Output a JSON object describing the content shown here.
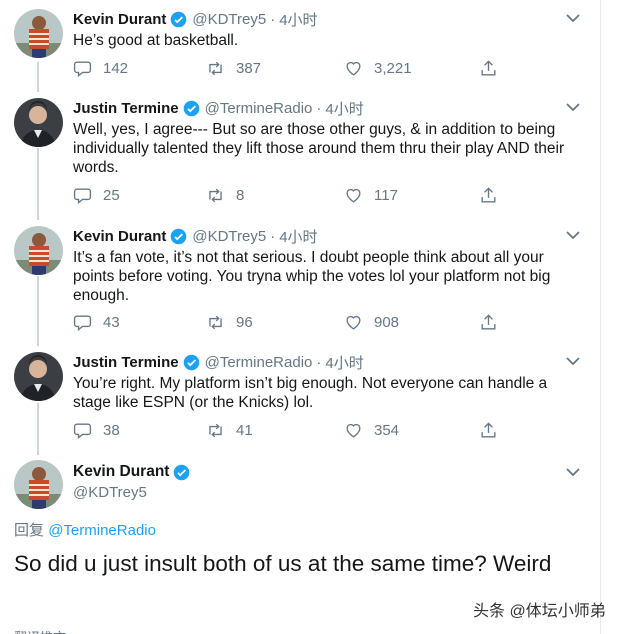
{
  "tweets": [
    {
      "name": "Kevin Durant",
      "handle": "@KDTrey5",
      "time": "4小时",
      "text": "He’s good at basketball.",
      "replies": "142",
      "retweets": "387",
      "likes": "3,221"
    },
    {
      "name": "Justin Termine",
      "handle": "@TermineRadio",
      "time": "4小时",
      "text": "Well, yes, I agree---  But so are those other guys, & in addition to being individually talented they lift those around them thru their play AND their words.",
      "replies": "25",
      "retweets": "8",
      "likes": "117"
    },
    {
      "name": "Kevin Durant",
      "handle": "@KDTrey5",
      "time": "4小时",
      "text": "It’s a fan vote, it’s not that serious. I doubt people think about all your points before voting. You tryna whip the votes lol your platform not big enough.",
      "replies": "43",
      "retweets": "96",
      "likes": "908"
    },
    {
      "name": "Justin Termine",
      "handle": "@TermineRadio",
      "time": "4小时",
      "text": "You’re right. My platform isn’t big enough. Not everyone can handle a stage like ESPN (or the Knicks) lol.",
      "replies": "38",
      "retweets": "41",
      "likes": "354"
    }
  ],
  "main_tweet": {
    "name": "Kevin Durant",
    "handle": "@KDTrey5",
    "reply_prefix": "回复",
    "reply_to": "@TermineRadio",
    "text": "So did u just insult both of us at the same time? Weird"
  },
  "watermark": "头条 @体坛小师弟",
  "cut_text": "翻译推文",
  "colors": {
    "accent": "#1da1f2",
    "secondary_text": "#657786",
    "thread_line": "#ccd6dd"
  },
  "icons": [
    "reply-icon",
    "retweet-icon",
    "like-icon",
    "share-icon",
    "verified-badge-icon",
    "chevron-down-icon"
  ]
}
